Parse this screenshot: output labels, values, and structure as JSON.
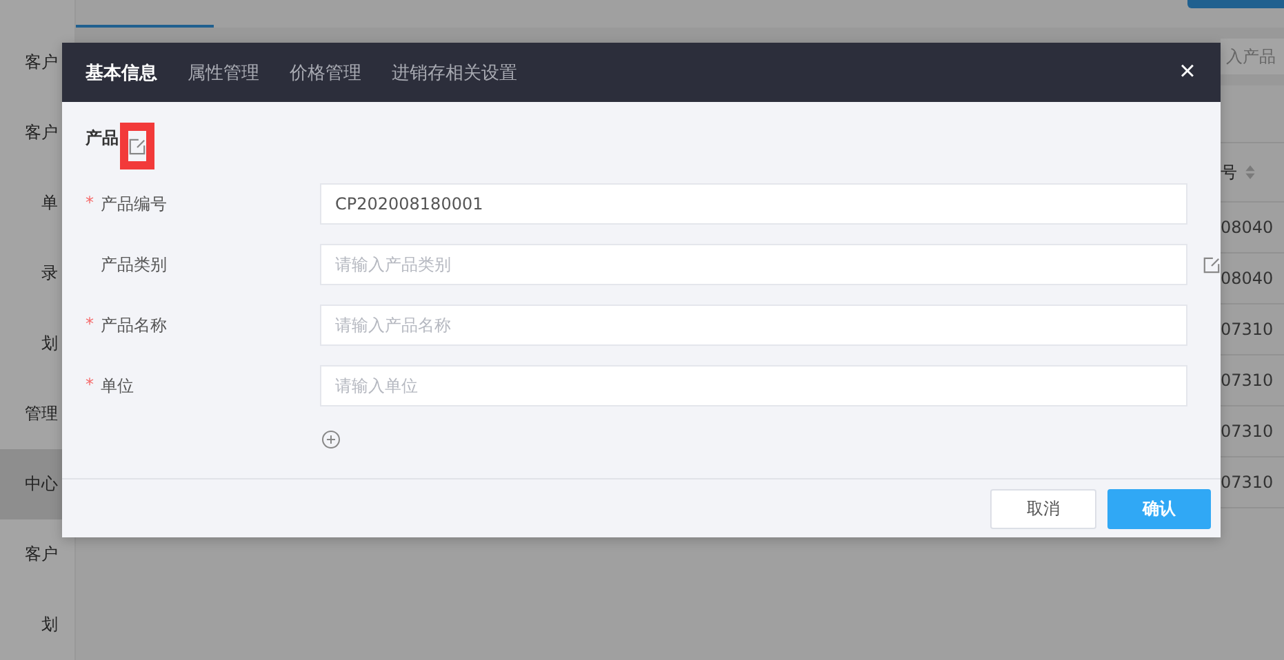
{
  "background": {
    "sidebar": [
      {
        "label": "客户",
        "selected": false
      },
      {
        "label": "客户",
        "selected": false
      },
      {
        "label": "单",
        "selected": false
      },
      {
        "label": "录",
        "selected": false
      },
      {
        "label": "划",
        "selected": false
      },
      {
        "label": "管理",
        "selected": false
      },
      {
        "label": "中心",
        "selected": true
      },
      {
        "label": "客户",
        "selected": false
      },
      {
        "label": "划",
        "selected": false
      }
    ],
    "search": {
      "placeholder": "入产品"
    },
    "table": {
      "column": "号",
      "rows": [
        "08040",
        "08040",
        "07310",
        "07310",
        "07310",
        "07310"
      ]
    }
  },
  "dialog": {
    "tabs": [
      {
        "label": "基本信息",
        "selected": true
      },
      {
        "label": "属性管理",
        "selected": false
      },
      {
        "label": "价格管理",
        "selected": false
      },
      {
        "label": "进销存相关设置",
        "selected": false
      }
    ],
    "close": "×",
    "section": {
      "title": "产品"
    },
    "fields": [
      {
        "label": "产品编号",
        "required_mark": "*",
        "value": "CP202008180001",
        "editable": false
      },
      {
        "label": "产品类别",
        "placeholder": "请输入产品类别",
        "editable": true
      },
      {
        "label": "产品名称",
        "required_mark": "*",
        "placeholder": "请输入产品名称",
        "editable": false
      },
      {
        "label": "单位",
        "required_mark": "*",
        "placeholder": "请输入单位",
        "editable": false
      }
    ],
    "buttons": [
      {
        "label": "取消",
        "kind": "default"
      },
      {
        "label": "确认",
        "kind": "primary"
      }
    ]
  }
}
